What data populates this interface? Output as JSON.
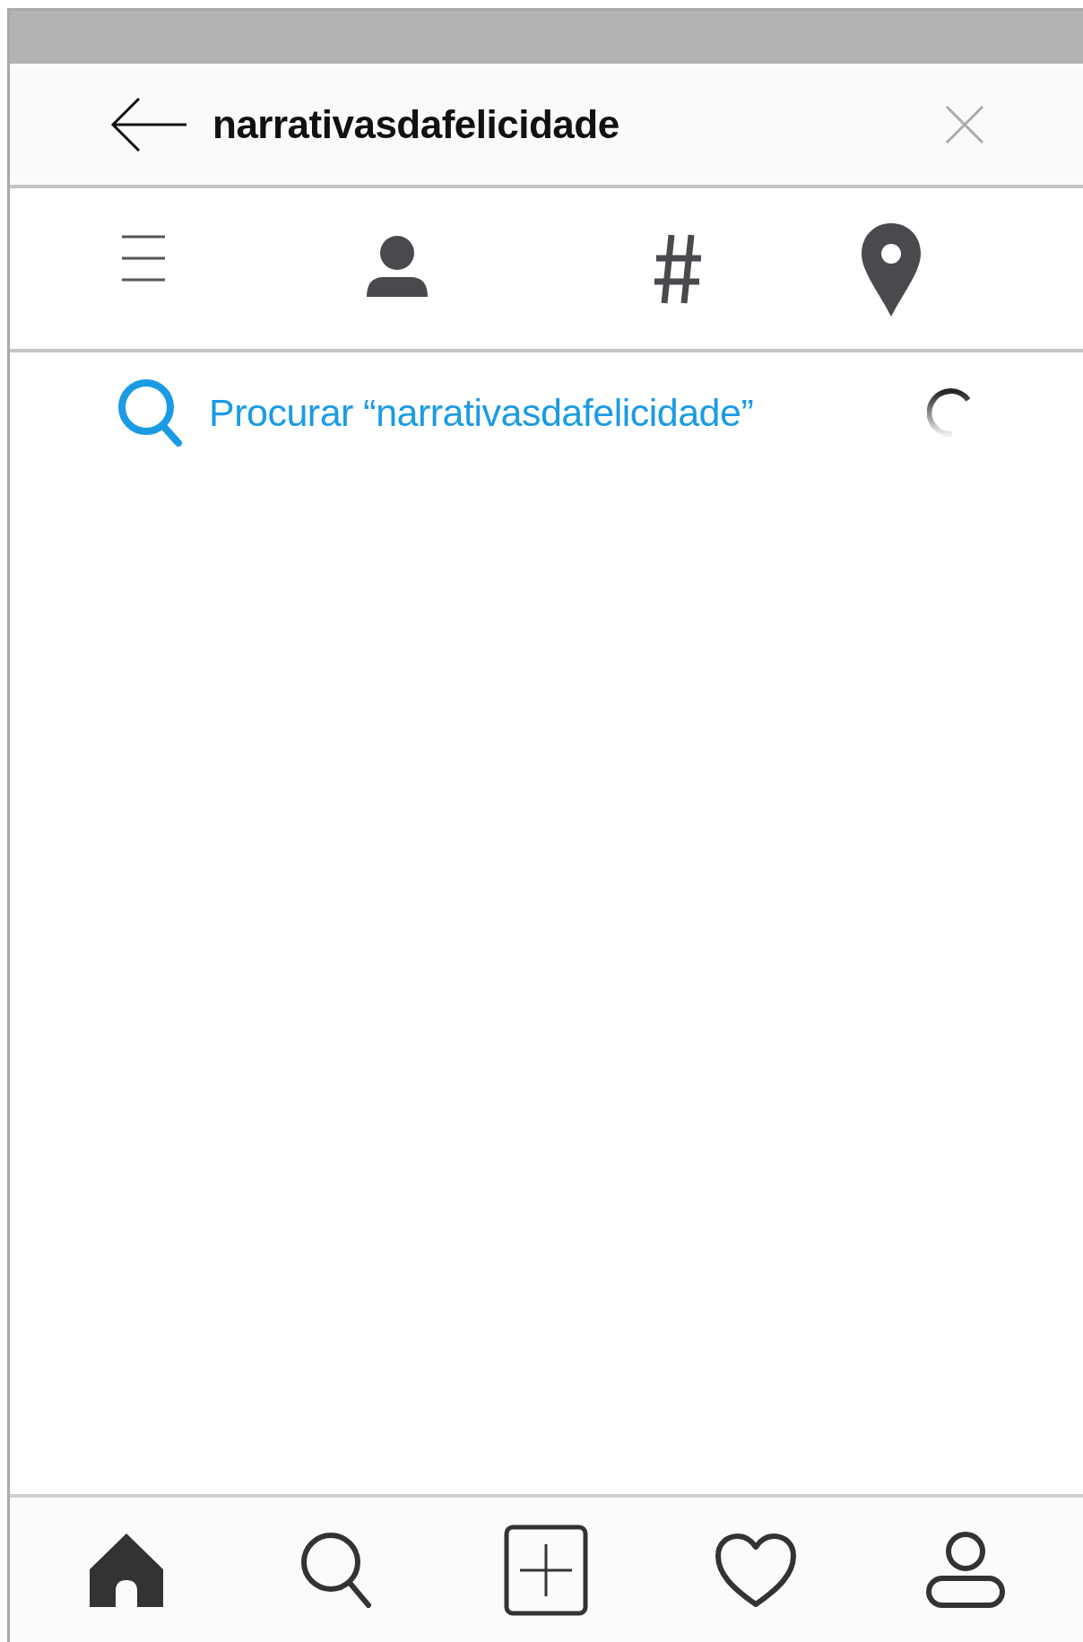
{
  "search_bar": {
    "query": "narrativasdafelicidade"
  },
  "filter_tabs": [
    {
      "kind": "top"
    },
    {
      "kind": "people"
    },
    {
      "kind": "tags"
    },
    {
      "kind": "places"
    }
  ],
  "suggestion": {
    "text": "Procurar “narrativasdafelicidade”",
    "loading": true
  },
  "bottom_nav": [
    {
      "kind": "home",
      "selected": true
    },
    {
      "kind": "search",
      "selected": false
    },
    {
      "kind": "add",
      "selected": false
    },
    {
      "kind": "activity",
      "selected": false
    },
    {
      "kind": "profile",
      "selected": false
    }
  ]
}
